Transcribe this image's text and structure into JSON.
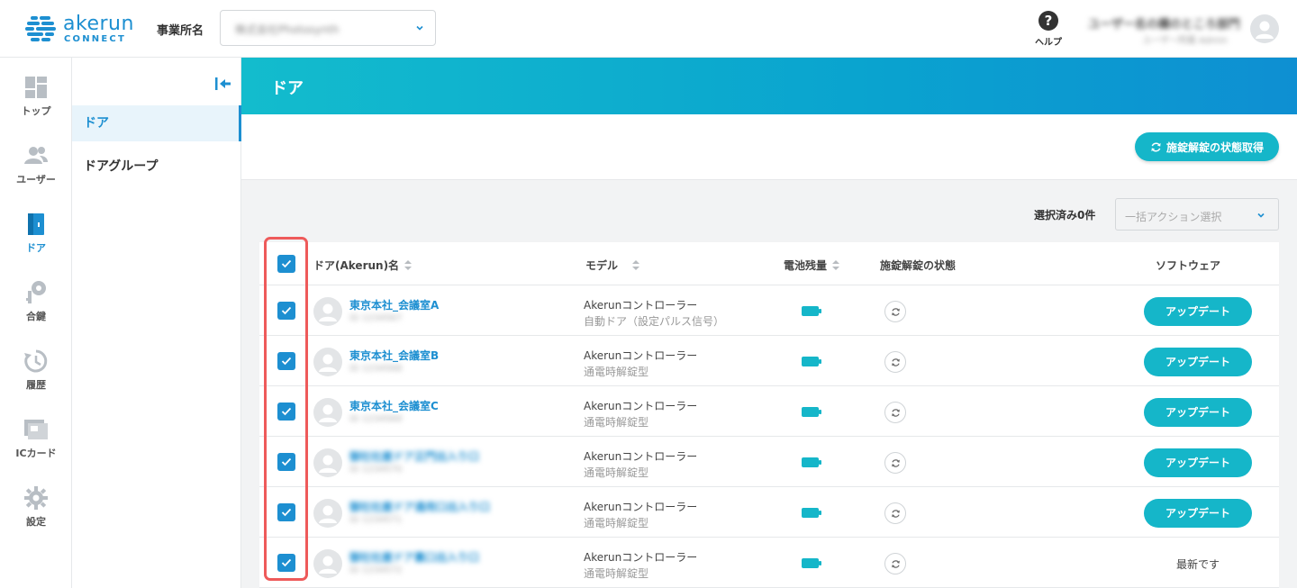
{
  "header": {
    "logo_name": "akerun",
    "logo_sub": "CONNECT",
    "office_label": "事業所名",
    "office_value": "株式会社Photosynth",
    "help_label": "ヘルプ",
    "user_name": "ユーザー名の欄のところ部門",
    "user_org": "ユーザー所属 Admin"
  },
  "iconnav": [
    {
      "label": "トップ",
      "icon": "dashboard-icon"
    },
    {
      "label": "ユーザー",
      "icon": "users-icon"
    },
    {
      "label": "ドア",
      "icon": "door-icon",
      "active": true
    },
    {
      "label": "合鍵",
      "icon": "key-icon"
    },
    {
      "label": "履歴",
      "icon": "history-icon"
    },
    {
      "label": "ICカード",
      "icon": "ic-card-icon"
    },
    {
      "label": "設定",
      "icon": "gear-icon"
    }
  ],
  "subnav": {
    "items": [
      {
        "label": "ドア",
        "active": true
      },
      {
        "label": "ドアグループ"
      }
    ]
  },
  "page": {
    "title": "ドア",
    "status_button": "施錠解錠の状態取得",
    "selected_count": "選択済み0件",
    "bulk_placeholder": "一括アクション選択"
  },
  "table": {
    "columns": [
      "ドア(Akerun)名",
      "モデル",
      "電池残量",
      "施錠解錠の状態",
      "ソフトウェア"
    ],
    "rows": [
      {
        "name": "東京本社_会議室A",
        "sub": "ID 1234567",
        "model1": "Akerunコントローラー",
        "model2": "自動ドア（設定パルス信号）",
        "software": "アップデート",
        "update": true
      },
      {
        "name": "東京本社_会議室B",
        "sub": "ID 1234568",
        "model1": "Akerunコントローラー",
        "model2": "通電時解錠型",
        "software": "アップデート",
        "update": true
      },
      {
        "name": "東京本社_会議室C",
        "sub": "ID 1234569",
        "model1": "Akerunコントローラー",
        "model2": "通電時解錠型",
        "software": "アップデート",
        "update": true
      },
      {
        "name": "御社社屋ドア正門出入り口",
        "sub": "ID 1234570",
        "model1": "Akerunコントローラー",
        "model2": "通電時解錠型",
        "software": "アップデート",
        "update": true,
        "blur": true
      },
      {
        "name": "御社社屋ドア通用口出入り口",
        "sub": "ID 1234571",
        "model1": "Akerunコントローラー",
        "model2": "通電時解錠型",
        "software": "アップデート",
        "update": true,
        "blur": true
      },
      {
        "name": "御社社屋ドア裏口出入り口",
        "sub": "ID 1234572",
        "model1": "Akerunコントローラー",
        "model2": "通電時解錠型",
        "software": "最新です",
        "update": false,
        "blur": true
      }
    ]
  },
  "colors": {
    "accent": "#1d8fd1",
    "button": "#15b6c9",
    "highlight": "#ee5a5a"
  }
}
